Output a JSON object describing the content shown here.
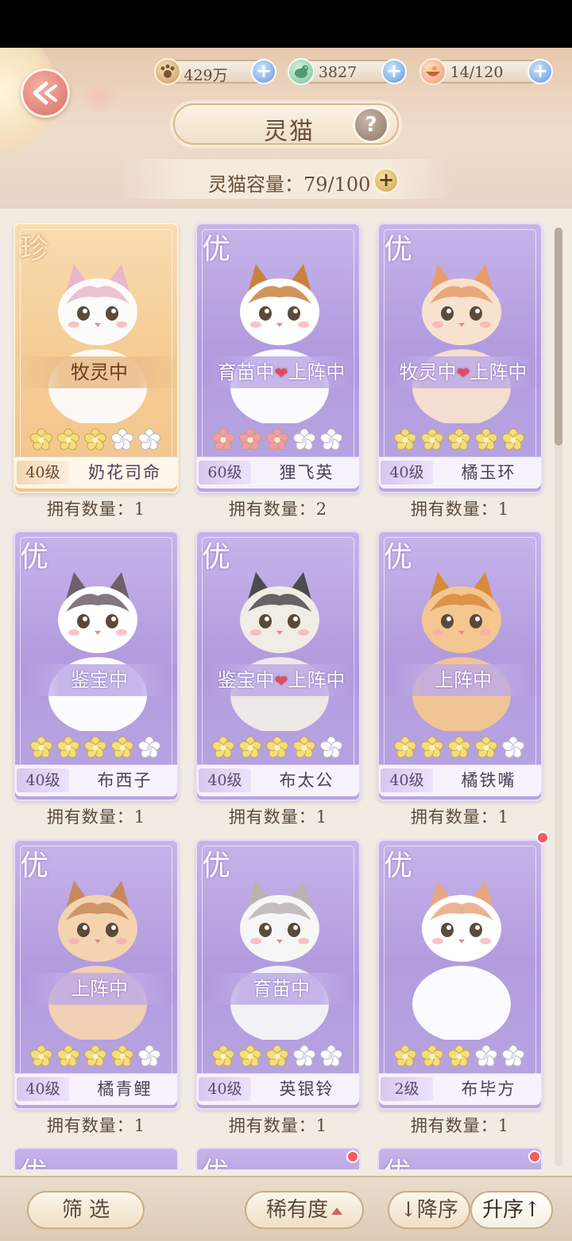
{
  "header": {
    "title": "灵猫",
    "resources": [
      {
        "icon": "paw-coin-icon",
        "value": "429万"
      },
      {
        "icon": "jade-bird-icon",
        "value": "3827"
      },
      {
        "icon": "food-bowl-icon",
        "value": "14/120"
      }
    ],
    "capacity_label": "灵猫容量：79/100"
  },
  "cards": [
    {
      "rank": "珍",
      "status": "牧灵中",
      "status_heart": false,
      "status_tail": "",
      "stars_total": 5,
      "stars_filled": 3,
      "star_color": "#f3de7c",
      "level": "40级",
      "name": "奶花司命",
      "count": "拥有数量：1",
      "gold": true,
      "dot": false
    },
    {
      "rank": "优",
      "status": "育苗中",
      "status_heart": true,
      "status_tail": "上阵中",
      "stars_total": 5,
      "stars_filled": 3,
      "star_color": "#f29ab0",
      "level": "60级",
      "name": "狸飞英",
      "count": "拥有数量：2",
      "gold": false,
      "dot": false
    },
    {
      "rank": "优",
      "status": "牧灵中",
      "status_heart": true,
      "status_tail": "上阵中",
      "stars_total": 5,
      "stars_filled": 5,
      "star_color": "#f3de7c",
      "level": "40级",
      "name": "橘玉环",
      "count": "拥有数量：1",
      "gold": false,
      "dot": false
    },
    {
      "rank": "优",
      "status": "鉴宝中",
      "status_heart": false,
      "status_tail": "",
      "stars_total": 5,
      "stars_filled": 4,
      "star_color": "#f3de7c",
      "level": "40级",
      "name": "布西子",
      "count": "拥有数量：1",
      "gold": false,
      "dot": false
    },
    {
      "rank": "优",
      "status": "鉴宝中",
      "status_heart": true,
      "status_tail": "上阵中",
      "stars_total": 5,
      "stars_filled": 4,
      "star_color": "#f3de7c",
      "level": "40级",
      "name": "布太公",
      "count": "拥有数量：1",
      "gold": false,
      "dot": false
    },
    {
      "rank": "优",
      "status": "上阵中",
      "status_heart": false,
      "status_tail": "",
      "stars_total": 5,
      "stars_filled": 4,
      "star_color": "#f3de7c",
      "level": "40级",
      "name": "橘铁嘴",
      "count": "拥有数量：1",
      "gold": false,
      "dot": false
    },
    {
      "rank": "优",
      "status": "上阵中",
      "status_heart": false,
      "status_tail": "",
      "stars_total": 5,
      "stars_filled": 4,
      "star_color": "#f3de7c",
      "level": "40级",
      "name": "橘青鲤",
      "count": "拥有数量：1",
      "gold": false,
      "dot": false
    },
    {
      "rank": "优",
      "status": "育苗中",
      "status_heart": false,
      "status_tail": "",
      "stars_total": 5,
      "stars_filled": 3,
      "star_color": "#f3de7c",
      "level": "40级",
      "name": "英银铃",
      "count": "拥有数量：1",
      "gold": false,
      "dot": false
    },
    {
      "rank": "优",
      "status": "",
      "status_heart": false,
      "status_tail": "",
      "stars_total": 5,
      "stars_filled": 3,
      "star_color": "#f3de7c",
      "level": "2级",
      "name": "布毕方",
      "count": "拥有数量：1",
      "gold": false,
      "dot": true
    }
  ],
  "peek_cards": [
    {
      "rank": "优",
      "dot": false
    },
    {
      "rank": "优",
      "dot": true
    },
    {
      "rank": "优",
      "dot": true
    }
  ],
  "footer": {
    "filter_label": "筛 选",
    "sort_label": "稀有度",
    "desc_label": "↓降序",
    "asc_label": "升序↑"
  },
  "colors": {
    "card_purple": "#b29cde",
    "card_gold": "#f5cd96",
    "plus_blue": "#5f98e0",
    "back_red": "#d96f66",
    "notify_red": "#f05d5d"
  }
}
